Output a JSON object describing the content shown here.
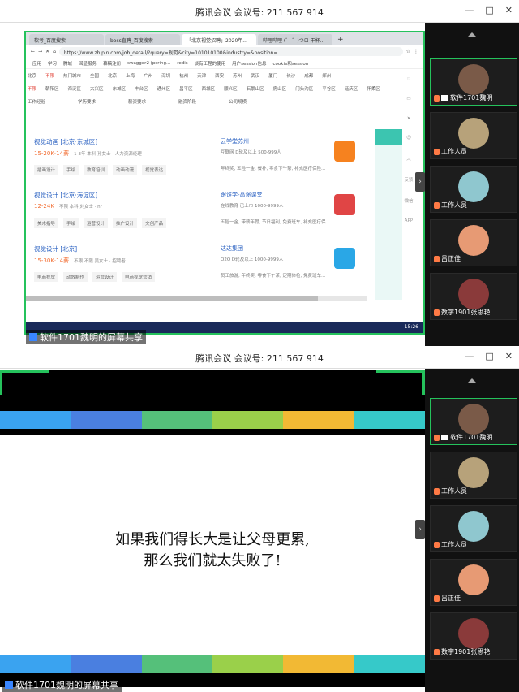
{
  "meeting": {
    "title": "腾讯会议 会议号: 211 567 914",
    "controls": [
      "—",
      "□",
      "✕"
    ]
  },
  "share_label": "软件1701魏明的屏幕共享",
  "participants": [
    {
      "name": "软件1701魏明",
      "avatar_color": "#7a5a48",
      "active": true
    },
    {
      "name": "工作人员",
      "avatar_color": "#b7a27a"
    },
    {
      "name": "工作人员",
      "avatar_color": "#8fc7cf"
    },
    {
      "name": "吕正佳",
      "avatar_color": "#e79a74"
    },
    {
      "name": "数字1901张思艳",
      "avatar_color": "#8a3a3a"
    }
  ],
  "browser": {
    "tabs": [
      "软考_百度搜索",
      "boss直聘_百度搜索",
      "「北京视觉招聘」2020年...",
      "哔哩哔哩 (゜-゜)つロ 干杯..."
    ],
    "url": "https://www.zhipin.com/job_detail/?query=视觉&city=101010100&industry=&position=",
    "bookmarks": [
      "应用",
      "学习",
      "腾城",
      "回显服务",
      "慕稿注册",
      "swagger2 (psring...",
      "redis",
      "谈有工程的使用",
      "用户session信息",
      "cookie和session"
    ],
    "filters_city": [
      "北京",
      "不限",
      "热门城市",
      "全国",
      "北京",
      "上海",
      "广州",
      "深圳",
      "杭州",
      "天津",
      "西安",
      "苏州",
      "武汉",
      "厦门",
      "长沙",
      "成都",
      "郑州"
    ],
    "filters_district": [
      "不限",
      "朝阳区",
      "海淀区",
      "大兴区",
      "东城区",
      "丰台区",
      "通州区",
      "昌平区",
      "西城区",
      "顺义区",
      "石景山区",
      "房山区",
      "门头沟区",
      "平谷区",
      "延庆区",
      "怀柔区"
    ],
    "filters_more": [
      "工作经验",
      "学历要求",
      "薪资要求",
      "融资阶段",
      "公司规模"
    ],
    "jobs": [
      {
        "title": "视觉动画 [北京·东城区]",
        "salary": "15-20K·14薪",
        "meta": "1-3年  本科  孙女士 · 人力资源经理",
        "tags": [
          "插画设计",
          "手绘",
          "教育培训",
          "动画动漫",
          "视觉表达"
        ],
        "company": "云学堂苏州",
        "cinfo": "互联网  D轮及以上  500-999人",
        "benefit": "年终奖, 五险一金, 餐补, 零食下午茶, 补充医疗保险...",
        "logo_color": "#f6821f"
      },
      {
        "title": "视觉设计 [北京·海淀区]",
        "salary": "12-24K",
        "meta": "不限  本科  刘女士 · hr",
        "tags": [
          "美术指导",
          "手绘",
          "运营设计",
          "推广设计",
          "文创产品"
        ],
        "company": "跟谁学-高途课堂",
        "cinfo": "在线教育  已上市  1000-9999人",
        "benefit": "五险一金, 带薪年假, 节日福利, 免费班车, 补充医疗保...",
        "logo_color": "#e04545"
      },
      {
        "title": "视觉设计 [北京]",
        "salary": "15-30K·14薪",
        "meta": "不限  不限  吴女士 · 招聘者",
        "tags": [
          "电商视觉",
          "动效制作",
          "运营设计",
          "电商视觉营销"
        ],
        "company": "达达集团",
        "cinfo": "O2O  D轮及以上  1000-9999人",
        "benefit": "员工旅游, 年终奖, 零食下午茶, 定期体检, 免费班车...",
        "logo_color": "#2aa7e6"
      }
    ],
    "side_tools": [
      "反馈",
      "微信",
      "APP"
    ],
    "taskbar_time": "15:26"
  },
  "slide": {
    "line1": "如果我们得长大是让父母更累,",
    "line2": "那么我们就太失败了!",
    "bar_colors": [
      "#3aa3f0",
      "#4a7fe0",
      "#55c07a",
      "#9ad04a",
      "#f2b934",
      "#36c9c9"
    ]
  }
}
